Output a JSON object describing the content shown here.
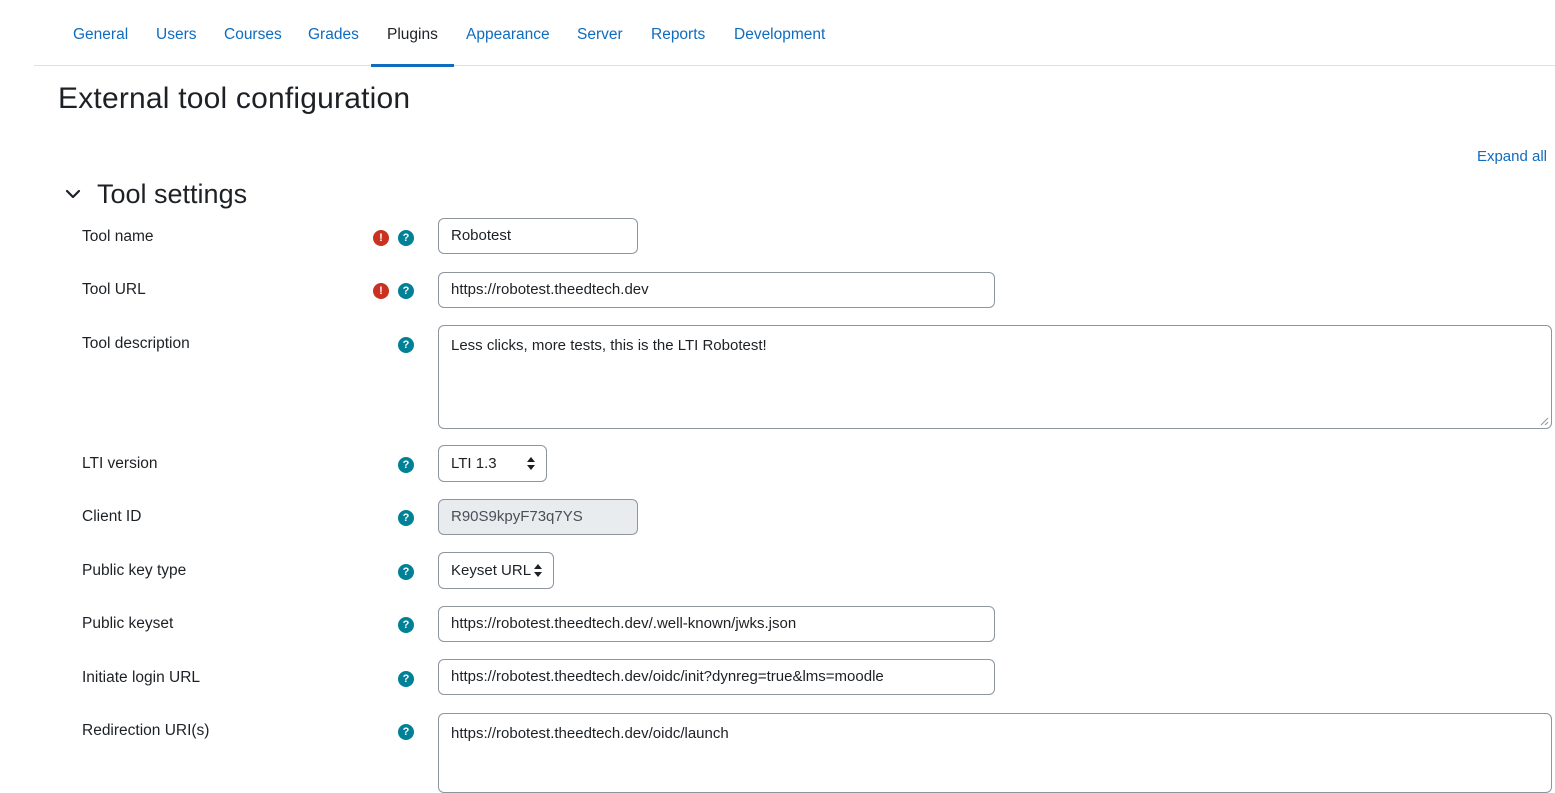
{
  "nav": {
    "tabs": [
      {
        "label": "General"
      },
      {
        "label": "Users"
      },
      {
        "label": "Courses"
      },
      {
        "label": "Grades"
      },
      {
        "label": "Plugins",
        "active": true
      },
      {
        "label": "Appearance"
      },
      {
        "label": "Server"
      },
      {
        "label": "Reports"
      },
      {
        "label": "Development"
      }
    ]
  },
  "page": {
    "title": "External tool configuration",
    "expand_all": "Expand all"
  },
  "section": {
    "title": "Tool settings",
    "icon": "chevron-down-icon"
  },
  "form": {
    "tool_name": {
      "label": "Tool name",
      "value": "Robotest",
      "required": true
    },
    "tool_url": {
      "label": "Tool URL",
      "value": "https://robotest.theedtech.dev",
      "required": true
    },
    "tool_description": {
      "label": "Tool description",
      "value": "Less clicks, more tests, this is the LTI Robotest!"
    },
    "lti_version": {
      "label": "LTI version",
      "value": "LTI 1.3"
    },
    "client_id": {
      "label": "Client ID",
      "value": "R90S9kpyF73q7YS"
    },
    "public_key_type": {
      "label": "Public key type",
      "value": "Keyset URL"
    },
    "public_keyset": {
      "label": "Public keyset",
      "value": "https://robotest.theedtech.dev/.well-known/jwks.json"
    },
    "initiate_login_url": {
      "label": "Initiate login URL",
      "value": "https://robotest.theedtech.dev/oidc/init?dynreg=true&lms=moodle"
    },
    "redirection_uris": {
      "label": "Redirection URI(s)",
      "value": "https://robotest.theedtech.dev/oidc/launch"
    }
  },
  "icons": {
    "required": {
      "name": "required-icon",
      "glyph": "!",
      "color": "#ca3120"
    },
    "help": {
      "name": "help-icon",
      "glyph": "?",
      "color": "#008196"
    }
  },
  "colors": {
    "link": "#0f6cbf",
    "text": "#1d2125"
  }
}
